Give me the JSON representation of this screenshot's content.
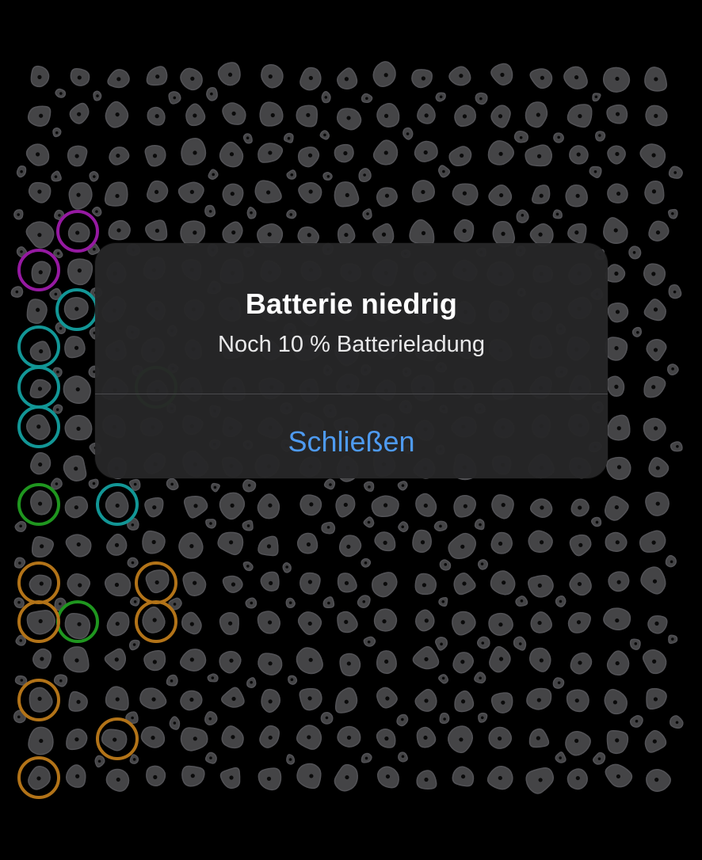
{
  "dialog": {
    "title": "Batterie niedrig",
    "message": "Noch 10 % Batterieladung",
    "close_button_label": "Schließen"
  },
  "board": {
    "hold_color": "#4a4a4d",
    "hold_highlight": "#5a5a5e",
    "marker_colors": {
      "start": "#a21caf",
      "intermediate": "#14a3a3",
      "hand": "#22a322",
      "foot": "#c27d1b"
    }
  }
}
